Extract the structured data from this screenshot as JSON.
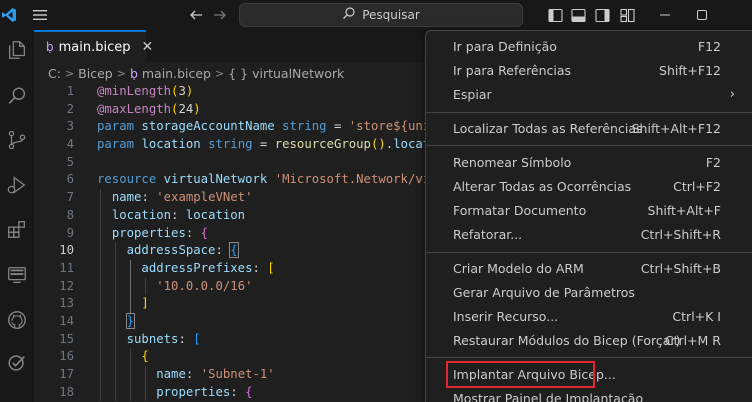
{
  "titlebar": {
    "search_placeholder": "Pesquisar",
    "icons": [
      "vscode-logo-icon",
      "menu-icon",
      "back-arrow-icon",
      "forward-arrow-icon",
      "search-icon",
      "toggle-primary-sidebar-icon",
      "toggle-panel-icon",
      "toggle-secondary-sidebar-icon",
      "customize-layout-icon",
      "minimize-icon",
      "maximize-icon"
    ]
  },
  "activity_bar": {
    "items": [
      "explorer-icon",
      "search-icon",
      "source-control-icon",
      "run-debug-icon",
      "extensions-icon",
      "remote-explorer-icon",
      "github-icon",
      "testing-icon"
    ]
  },
  "tab": {
    "icon_glyph": "ḅ",
    "label": "main.bicep",
    "close_glyph": "✕"
  },
  "breadcrumb": {
    "items": [
      "C:",
      "Bicep",
      "main.bicep",
      "{ } virtualNetwork"
    ],
    "separator": ">"
  },
  "code": {
    "current_line": 10,
    "lines": [
      {
        "n": "1"
      },
      {
        "n": "2"
      },
      {
        "n": "3"
      },
      {
        "n": "4"
      },
      {
        "n": "5"
      },
      {
        "n": "6"
      },
      {
        "n": "7"
      },
      {
        "n": "8"
      },
      {
        "n": "9"
      },
      {
        "n": "10"
      },
      {
        "n": "11"
      },
      {
        "n": "12"
      },
      {
        "n": "13"
      },
      {
        "n": "14"
      },
      {
        "n": "15"
      },
      {
        "n": "16"
      },
      {
        "n": "17"
      },
      {
        "n": "18"
      }
    ]
  },
  "context_menu": {
    "items": [
      {
        "label": "Ir para Definição",
        "shortcut": "F12"
      },
      {
        "label": "Ir para Referências",
        "shortcut": "Shift+F12"
      },
      {
        "label": "Espiar",
        "shortcut": ""
      },
      {
        "label": "Localizar Todas as Referências",
        "shortcut": "Shift+Alt+F12"
      },
      {
        "label": "Renomear Símbolo",
        "shortcut": "F2"
      },
      {
        "label": "Alterar Todas as Ocorrências",
        "shortcut": "Ctrl+F2"
      },
      {
        "label": "Formatar Documento",
        "shortcut": "Shift+Alt+F"
      },
      {
        "label": "Refatorar...",
        "shortcut": "Ctrl+Shift+R"
      },
      {
        "label": "Criar Modelo do ARM",
        "shortcut": "Ctrl+Shift+B"
      },
      {
        "label": "Gerar Arquivo de Parâmetros",
        "shortcut": ""
      },
      {
        "label": "Inserir Recurso...",
        "shortcut": "Ctrl+K I"
      },
      {
        "label": "Restaurar Módulos do Bicep (Forçar)",
        "shortcut": "Ctrl+M R"
      },
      {
        "label": "Implantar Arquivo Bicep...",
        "shortcut": ""
      },
      {
        "label": "Mostrar Painel de Implantação",
        "shortcut": ""
      }
    ],
    "submenu_glyph": "›",
    "highlight_color": "#e0262e"
  },
  "colors": {
    "accent": "#0078d4",
    "background": "#1f1f1f"
  }
}
